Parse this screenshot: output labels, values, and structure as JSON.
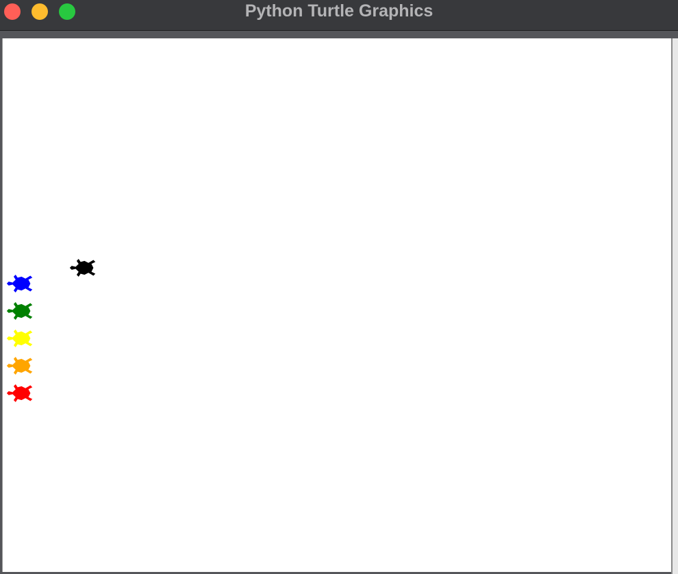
{
  "window": {
    "title": "Python Turtle Graphics"
  },
  "colors": {
    "close": "#ff5f57",
    "minimize": "#febc2e",
    "maximize": "#28c840",
    "canvas_background": "#ffffff"
  },
  "turtles": [
    {
      "name": "black",
      "color": "#000000"
    },
    {
      "name": "blue",
      "color": "#0000ff"
    },
    {
      "name": "green",
      "color": "#008000"
    },
    {
      "name": "yellow",
      "color": "#ffff00"
    },
    {
      "name": "orange",
      "color": "#ffa500"
    },
    {
      "name": "red",
      "color": "#ff0000"
    }
  ]
}
